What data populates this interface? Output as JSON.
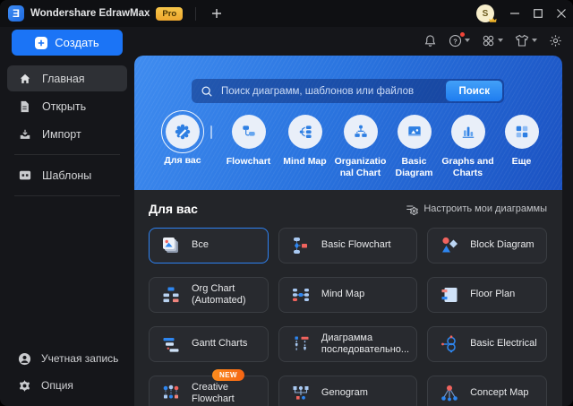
{
  "titlebar": {
    "app_title": "Wondershare EdrawMax",
    "plan_badge": "Pro",
    "avatar_initial": "S"
  },
  "toolbar": {
    "icons": [
      "bell",
      "help",
      "apps-grid",
      "theme-shirt",
      "settings-gear"
    ]
  },
  "sidebar": {
    "create_label": "Создать",
    "items": [
      {
        "label": "Главная",
        "icon": "home",
        "active": true
      },
      {
        "label": "Открыть",
        "icon": "document",
        "active": false
      },
      {
        "label": "Импорт",
        "icon": "import",
        "active": false
      },
      {
        "label": "Шаблоны",
        "icon": "templates",
        "active": false
      }
    ],
    "footer_items": [
      {
        "label": "Учетная запись",
        "icon": "user"
      },
      {
        "label": "Опция",
        "icon": "gear"
      }
    ]
  },
  "banner": {
    "search_placeholder": "Поиск диаграмм, шаблонов или файлов",
    "search_button_label": "Поиск",
    "categories": [
      {
        "label": "Для вас",
        "icon": "customize",
        "selected": true
      },
      {
        "label": "Flowchart",
        "icon": "flowchart",
        "selected": false
      },
      {
        "label": "Mind Map",
        "icon": "mind-map",
        "selected": false
      },
      {
        "label": "Organizational Chart",
        "icon": "org-chart",
        "selected": false
      },
      {
        "label": "Basic Diagram",
        "icon": "basic-diagram",
        "selected": false
      },
      {
        "label": "Graphs and Charts",
        "icon": "graphs-charts",
        "selected": false
      },
      {
        "label": "Еще",
        "icon": "more-grid",
        "selected": false
      }
    ]
  },
  "main": {
    "section_title": "Для вас",
    "customize_label": "Настроить мои диаграммы",
    "cards": [
      {
        "label": "Все",
        "icon": "all-templates",
        "selected": true
      },
      {
        "label": "Basic Flowchart",
        "icon": "basic-flowchart",
        "selected": false
      },
      {
        "label": "Block Diagram",
        "icon": "block-diagram",
        "selected": false
      },
      {
        "label": "Org Chart (Automated)",
        "icon": "org-chart",
        "selected": false
      },
      {
        "label": "Mind Map",
        "icon": "mind-map",
        "selected": false
      },
      {
        "label": "Floor Plan",
        "icon": "floor-plan",
        "selected": false
      },
      {
        "label": "Gantt Charts",
        "icon": "gantt-charts",
        "selected": false
      },
      {
        "label": "Диаграмма последовательно...",
        "icon": "sequence-diagram",
        "selected": false
      },
      {
        "label": "Basic Electrical",
        "icon": "basic-electrical",
        "selected": false
      },
      {
        "label": "Creative Flowchart",
        "icon": "creative-flowchart",
        "selected": false,
        "badge": "NEW"
      },
      {
        "label": "Genogram",
        "icon": "genogram",
        "selected": false
      },
      {
        "label": "Concept Map",
        "icon": "concept-map",
        "selected": false
      }
    ]
  },
  "colors": {
    "accent": "#2e82f2",
    "banner_gradient_start": "#3f8cf0",
    "banner_gradient_end": "#1b52c2",
    "pro_badge": "#f0b23c",
    "new_badge": "#f97316",
    "notification_dot": "#f04438",
    "panel_background": "#232529",
    "card_background": "#282a2f"
  }
}
